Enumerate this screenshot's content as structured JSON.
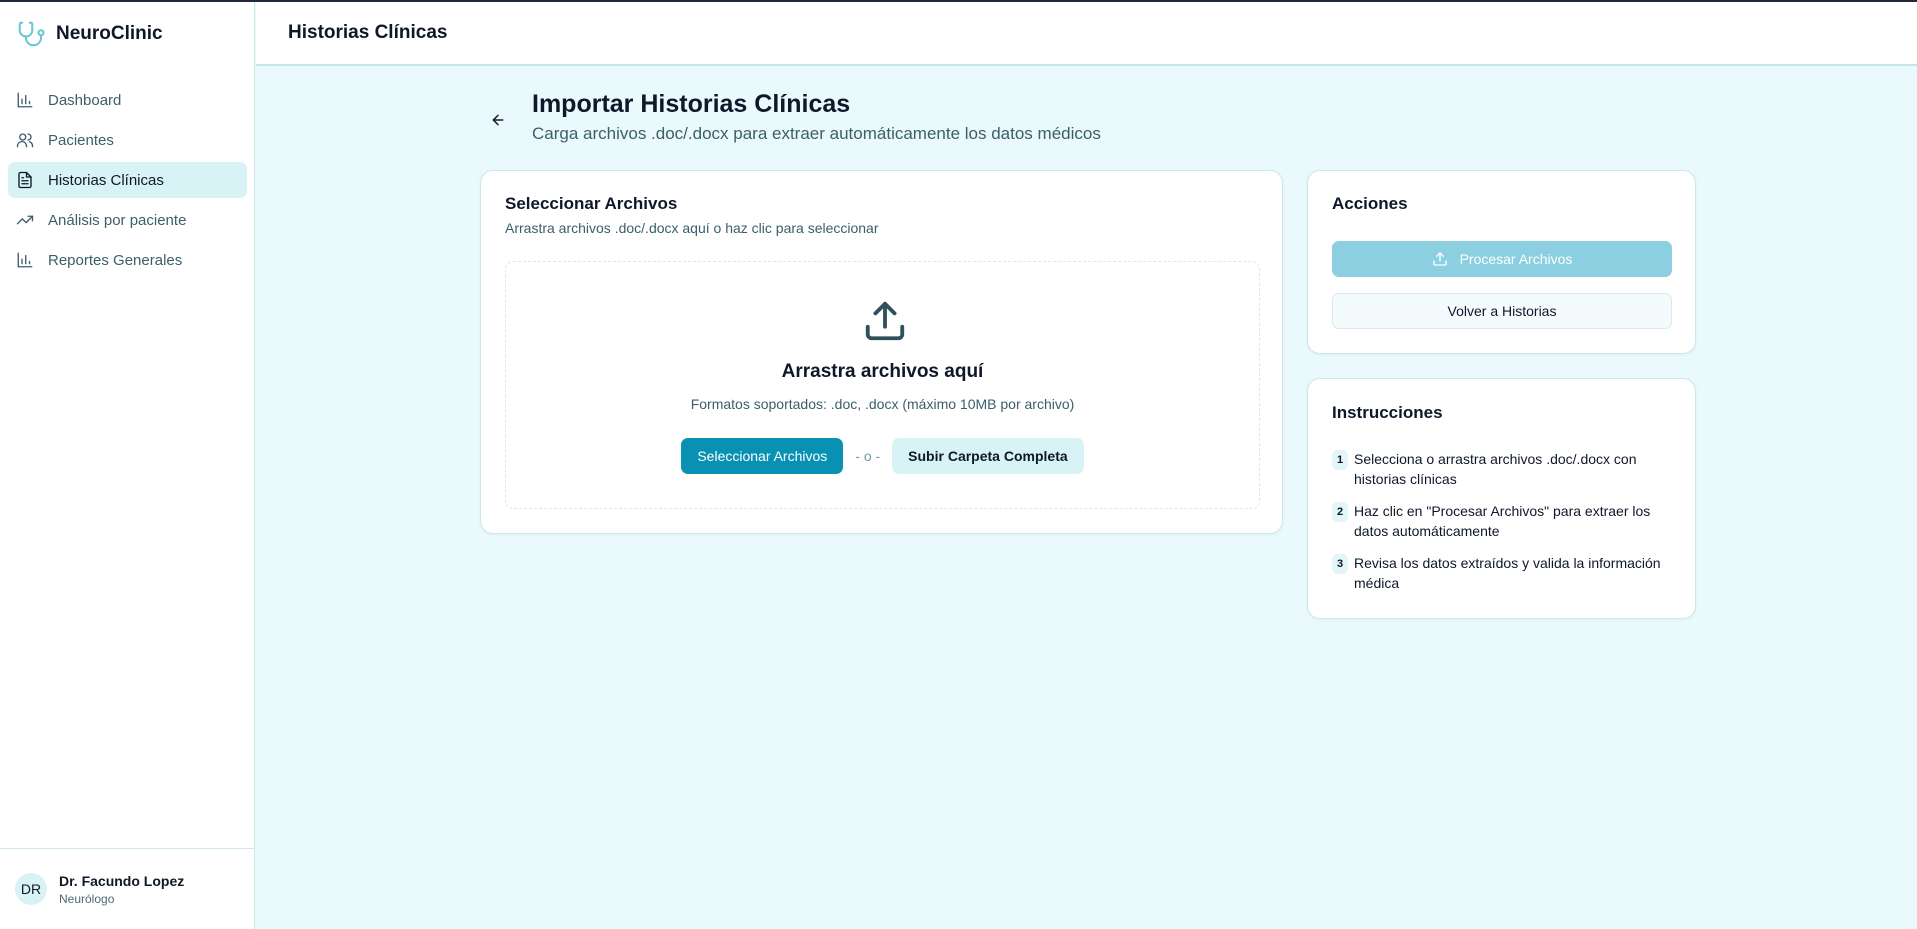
{
  "app": {
    "name": "NeuroClinic"
  },
  "sidebar": {
    "items": [
      {
        "label": "Dashboard",
        "icon": "bar-chart-icon",
        "active": false
      },
      {
        "label": "Pacientes",
        "icon": "users-icon",
        "active": false
      },
      {
        "label": "Historias Clínicas",
        "icon": "file-text-icon",
        "active": true
      },
      {
        "label": "Análisis por paciente",
        "icon": "trending-up-icon",
        "active": false
      },
      {
        "label": "Reportes Generales",
        "icon": "bar-chart-icon",
        "active": false
      }
    ],
    "user": {
      "initials": "DR",
      "name": "Dr. Facundo Lopez",
      "role": "Neurólogo"
    }
  },
  "header": {
    "title": "Historias Clínicas"
  },
  "page": {
    "title": "Importar Historias Clínicas",
    "subtitle": "Carga archivos .doc/.docx para extraer automáticamente los datos médicos"
  },
  "upload": {
    "title": "Seleccionar Archivos",
    "description": "Arrastra archivos .doc/.docx aquí o haz clic para seleccionar",
    "drop_title": "Arrastra archivos aquí",
    "formats": "Formatos soportados: .doc, .docx (máximo 10MB por archivo)",
    "select_label": "Seleccionar Archivos",
    "separator": "- o -",
    "folder_label": "Subir Carpeta Completa"
  },
  "actions": {
    "title": "Acciones",
    "process_label": "Procesar Archivos",
    "back_label": "Volver a Historias"
  },
  "instructions": {
    "title": "Instrucciones",
    "steps": [
      {
        "num": "1",
        "text": "Selecciona o arrastra archivos .doc/.docx con historias clínicas"
      },
      {
        "num": "2",
        "text": "Haz clic en \"Procesar Archivos\" para extraer los datos automáticamente"
      },
      {
        "num": "3",
        "text": "Revisa los datos extraídos y valida la información médica"
      }
    ]
  },
  "colors": {
    "primary": "#0891b2",
    "primary_disabled": "#8bcfe0",
    "background": "#eafafc",
    "active_nav": "#d8f3f6",
    "brand_icon": "#67c6d4"
  }
}
